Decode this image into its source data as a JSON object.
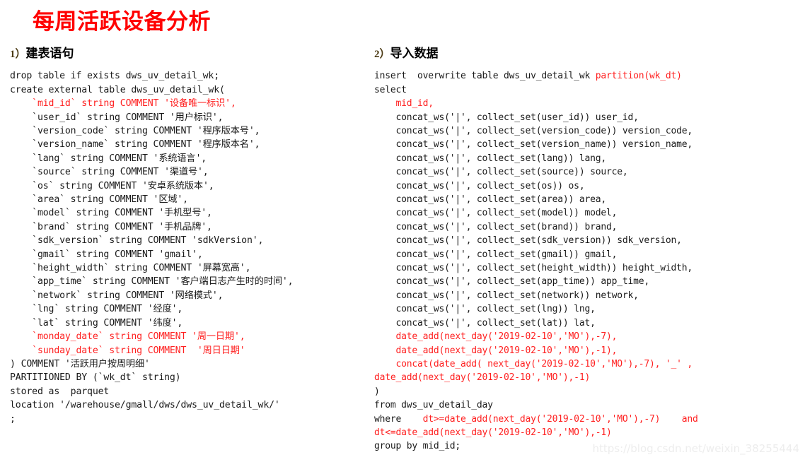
{
  "document": {
    "title": "每周活跃设备分析",
    "title_color": "#ff0000",
    "watermark": "https://blog.csdn.net/weixin_38255444"
  },
  "left_section": {
    "number": "1",
    "paren": "）",
    "heading": "建表语句",
    "code_lines": [
      [
        {
          "t": "drop table if exists dws_uv_detail_wk;",
          "c": "black"
        }
      ],
      [
        {
          "t": "create external table dws_uv_detail_wk(",
          "c": "black"
        }
      ],
      [
        {
          "t": "    `mid_id` string COMMENT '设备唯一标识',",
          "c": "red"
        }
      ],
      [
        {
          "t": "    `user_id` string COMMENT '用户标识',",
          "c": "black"
        }
      ],
      [
        {
          "t": "    `version_code` string COMMENT '程序版本号',",
          "c": "black"
        }
      ],
      [
        {
          "t": "    `version_name` string COMMENT '程序版本名',",
          "c": "black"
        }
      ],
      [
        {
          "t": "    `lang` string COMMENT '系统语言',",
          "c": "black"
        }
      ],
      [
        {
          "t": "    `source` string COMMENT '渠道号',",
          "c": "black"
        }
      ],
      [
        {
          "t": "    `os` string COMMENT '安卓系统版本',",
          "c": "black"
        }
      ],
      [
        {
          "t": "    `area` string COMMENT '区域',",
          "c": "black"
        }
      ],
      [
        {
          "t": "    `model` string COMMENT '手机型号',",
          "c": "black"
        }
      ],
      [
        {
          "t": "    `brand` string COMMENT '手机品牌',",
          "c": "black"
        }
      ],
      [
        {
          "t": "    `sdk_version` string COMMENT 'sdkVersion',",
          "c": "black"
        }
      ],
      [
        {
          "t": "    `gmail` string COMMENT 'gmail',",
          "c": "black"
        }
      ],
      [
        {
          "t": "    `height_width` string COMMENT '屏幕宽高',",
          "c": "black"
        }
      ],
      [
        {
          "t": "    `app_time` string COMMENT '客户端日志产生时的时间',",
          "c": "black"
        }
      ],
      [
        {
          "t": "    `network` string COMMENT '网络模式',",
          "c": "black"
        }
      ],
      [
        {
          "t": "    `lng` string COMMENT '经度',",
          "c": "black"
        }
      ],
      [
        {
          "t": "    `lat` string COMMENT '纬度',",
          "c": "black"
        }
      ],
      [
        {
          "t": "    `monday_date` string COMMENT '周一日期',",
          "c": "red"
        }
      ],
      [
        {
          "t": "    `sunday_date` string COMMENT  '周日日期'",
          "c": "red"
        }
      ],
      [
        {
          "t": ") COMMENT '活跃用户按周明细'",
          "c": "black"
        }
      ],
      [
        {
          "t": "PARTITIONED BY (`wk_dt` string)",
          "c": "black"
        }
      ],
      [
        {
          "t": "stored as  parquet",
          "c": "black"
        }
      ],
      [
        {
          "t": "location '/warehouse/gmall/dws/dws_uv_detail_wk/'",
          "c": "black"
        }
      ],
      [
        {
          "t": ";",
          "c": "black"
        }
      ]
    ]
  },
  "right_section": {
    "number": "2",
    "paren": "）",
    "heading": "导入数据",
    "code_lines": [
      [
        {
          "t": "insert  overwrite table dws_uv_detail_wk ",
          "c": "black"
        },
        {
          "t": "partition(wk_dt)",
          "c": "red"
        }
      ],
      [
        {
          "t": "select",
          "c": "black"
        }
      ],
      [
        {
          "t": "    mid_id,",
          "c": "red"
        }
      ],
      [
        {
          "t": "    concat_ws('|', collect_set(user_id)) user_id,",
          "c": "black"
        }
      ],
      [
        {
          "t": "    concat_ws('|', collect_set(version_code)) version_code,",
          "c": "black"
        }
      ],
      [
        {
          "t": "    concat_ws('|', collect_set(version_name)) version_name,",
          "c": "black"
        }
      ],
      [
        {
          "t": "    concat_ws('|', collect_set(lang)) lang,",
          "c": "black"
        }
      ],
      [
        {
          "t": "    concat_ws('|', collect_set(source)) source,",
          "c": "black"
        }
      ],
      [
        {
          "t": "    concat_ws('|', collect_set(os)) os,",
          "c": "black"
        }
      ],
      [
        {
          "t": "    concat_ws('|', collect_set(area)) area,",
          "c": "black"
        }
      ],
      [
        {
          "t": "    concat_ws('|', collect_set(model)) model,",
          "c": "black"
        }
      ],
      [
        {
          "t": "    concat_ws('|', collect_set(brand)) brand,",
          "c": "black"
        }
      ],
      [
        {
          "t": "    concat_ws('|', collect_set(sdk_version)) sdk_version,",
          "c": "black"
        }
      ],
      [
        {
          "t": "    concat_ws('|', collect_set(gmail)) gmail,",
          "c": "black"
        }
      ],
      [
        {
          "t": "    concat_ws('|', collect_set(height_width)) height_width,",
          "c": "black"
        }
      ],
      [
        {
          "t": "    concat_ws('|', collect_set(app_time)) app_time,",
          "c": "black"
        }
      ],
      [
        {
          "t": "    concat_ws('|', collect_set(network)) network,",
          "c": "black"
        }
      ],
      [
        {
          "t": "    concat_ws('|', collect_set(lng)) lng,",
          "c": "black"
        }
      ],
      [
        {
          "t": "    concat_ws('|', collect_set(lat)) lat,",
          "c": "black"
        }
      ],
      [
        {
          "t": "    date_add(next_day('2019-02-10','MO'),-7),",
          "c": "red"
        }
      ],
      [
        {
          "t": "    date_add(next_day('2019-02-10','MO'),-1),",
          "c": "red"
        }
      ],
      [
        {
          "t": "    concat(date_add( next_day('2019-02-10','MO'),-7), '_' ,",
          "c": "red"
        }
      ],
      [
        {
          "t": "date_add(next_day('2019-02-10','MO'),-1)",
          "c": "red"
        }
      ],
      [
        {
          "t": ")",
          "c": "black"
        }
      ],
      [
        {
          "t": "from dws_uv_detail_day",
          "c": "black"
        }
      ],
      [
        {
          "t": "where    ",
          "c": "black"
        },
        {
          "t": "dt>=date_add(next_day('2019-02-10','MO'),-7)    and",
          "c": "red"
        }
      ],
      [
        {
          "t": "dt<=date_add(next_day('2019-02-10','MO'),-1)",
          "c": "red"
        }
      ],
      [
        {
          "t": "group by mid_id;",
          "c": "black"
        }
      ]
    ]
  }
}
